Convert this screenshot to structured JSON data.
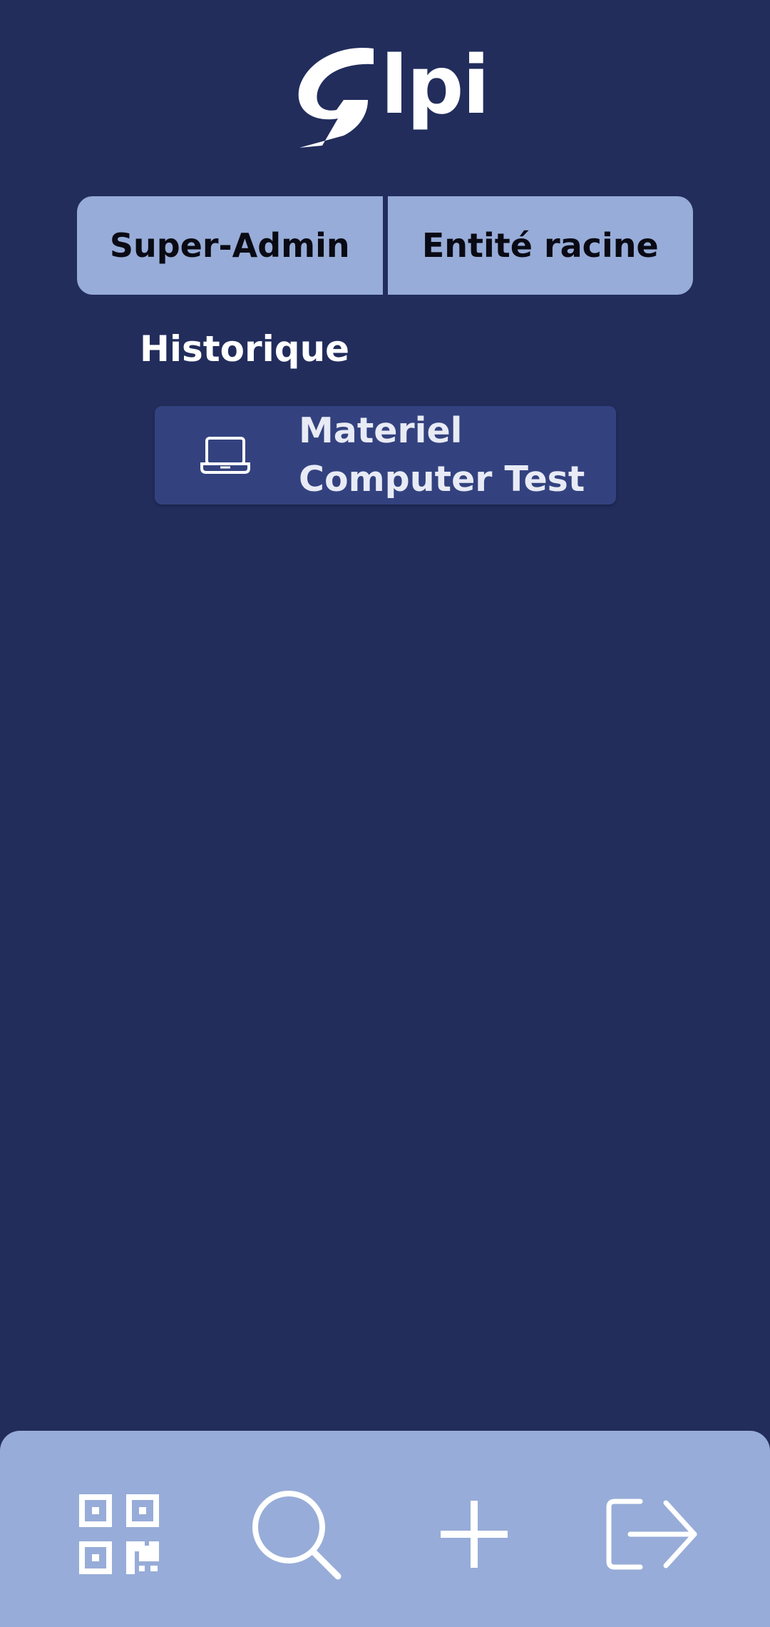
{
  "app": {
    "logo_text": "lpi"
  },
  "selector": {
    "profile": "Super-Admin",
    "entity": "Entité racine"
  },
  "history": {
    "title": "Historique",
    "items": [
      {
        "icon": "laptop-icon",
        "line1": "Materiel",
        "line2": "Computer Test"
      }
    ]
  },
  "bottom_nav": {
    "items": [
      {
        "icon": "qr-code-icon"
      },
      {
        "icon": "search-icon"
      },
      {
        "icon": "plus-icon"
      },
      {
        "icon": "logout-icon"
      }
    ]
  },
  "colors": {
    "background": "#222d5c",
    "accent": "#97acd8",
    "card": "#33427f"
  }
}
